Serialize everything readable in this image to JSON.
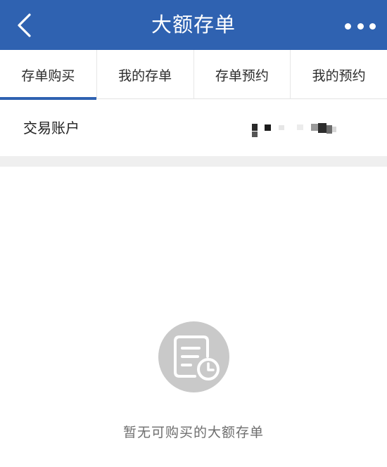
{
  "header": {
    "title": "大额存单",
    "back_icon": "chevron-left-icon",
    "more_icon": "more-horizontal-icon",
    "background_color": "#2f62b1"
  },
  "tabs": [
    {
      "label": "存单购买",
      "active": true
    },
    {
      "label": "我的存单",
      "active": false
    },
    {
      "label": "存单预约",
      "active": false
    },
    {
      "label": "我的预约",
      "active": false
    }
  ],
  "account": {
    "label": "交易账户"
  },
  "empty_state": {
    "icon": "document-clock-icon",
    "message": "暂无可购买的大额存单"
  }
}
